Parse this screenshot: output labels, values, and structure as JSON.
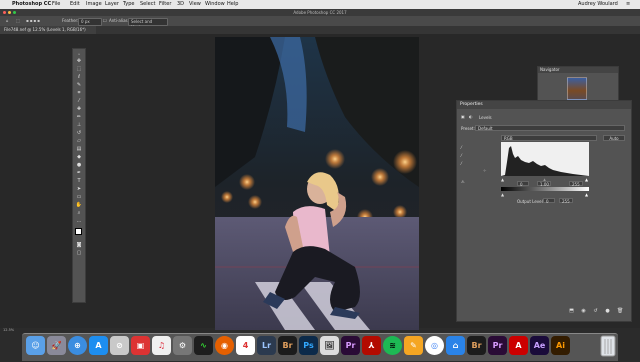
{
  "menubar": {
    "items": [
      "Photoshop CC",
      "File",
      "Edit",
      "Image",
      "Layer",
      "Type",
      "Select",
      "Filter",
      "3D",
      "View",
      "Window",
      "Help"
    ],
    "user": "Audrey Woulard"
  },
  "window": {
    "title": "Adobe Photoshop CC 2017"
  },
  "options": {
    "feather_label": "Feather:",
    "feather_value": "0 px",
    "antialias_label": "Anti-alias",
    "select_mask_label": "Select and Mask..."
  },
  "document": {
    "tab_label": "File748.nef @ 12.5% (Levels 1, RGB/16*)"
  },
  "navigator": {
    "title": "Navigator"
  },
  "properties": {
    "title": "Properties",
    "adjustment_label": "Levels",
    "preset_label": "Preset:",
    "preset_value": "Default",
    "channel_value": "RGB",
    "auto_label": "Auto",
    "input_values": [
      "0",
      "1.00",
      "255"
    ],
    "output_label": "Output Levels:",
    "output_values": [
      "0",
      "255"
    ]
  },
  "status": {
    "zoom": "12.5%"
  },
  "dock": {
    "icons": [
      "finder-icon",
      "launchpad-icon",
      "safari-icon",
      "app-store-icon",
      "calendar-icon",
      "photos-icon",
      "itunes-icon",
      "system-preferences-icon",
      "activity-monitor-icon",
      "firefox-icon",
      "calendar-date-icon",
      "lightroom-icon",
      "bridge-icon",
      "photoshop-icon",
      "preview-icon",
      "premiere-icon",
      "acrobat-icon",
      "spotify-icon",
      "pages-icon",
      "chrome-icon",
      "home-icon",
      "bridge-cc-icon",
      "premiere-pro-icon",
      "adobe-icon",
      "after-effects-icon",
      "illustrator-icon",
      "trash-icon"
    ],
    "labels": {
      "lightroom": "Lr",
      "bridge": "Br",
      "photoshop": "Ps",
      "premiere": "Pr",
      "bridge2": "Br",
      "premiere2": "Pr",
      "aftereffects": "Ae",
      "illustrator": "Ai",
      "calendar_day": "4"
    }
  },
  "colors": {
    "panel": "#535353",
    "background": "#282828",
    "lightroom": "#2b3a4f",
    "photoshop": "#0c2a4a",
    "premiere": "#2a0b36",
    "after_effects": "#1a0b3a",
    "illustrator": "#331c00"
  }
}
